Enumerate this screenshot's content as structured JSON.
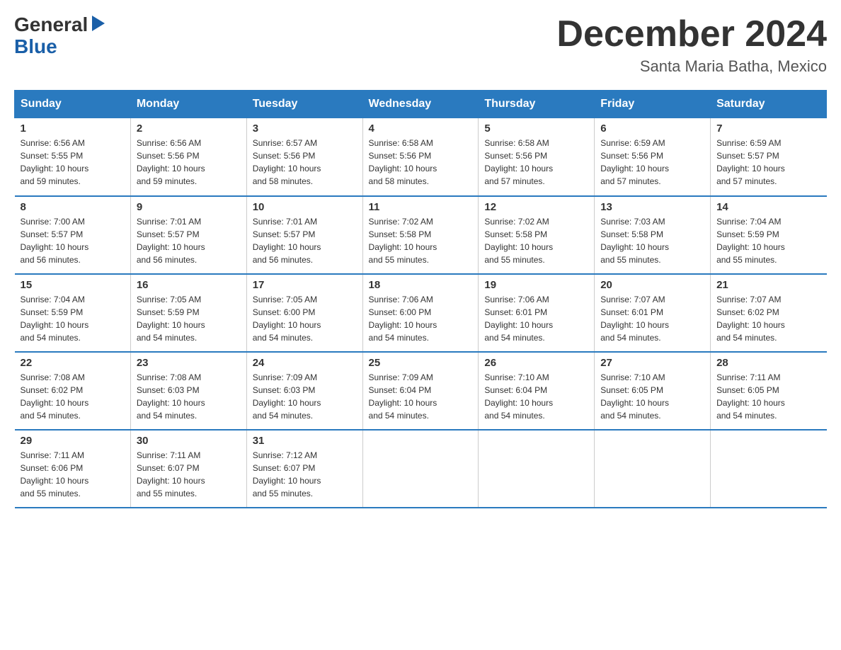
{
  "logo": {
    "text_general": "General",
    "text_blue": "Blue"
  },
  "title": "December 2024",
  "location": "Santa Maria Batha, Mexico",
  "days_of_week": [
    "Sunday",
    "Monday",
    "Tuesday",
    "Wednesday",
    "Thursday",
    "Friday",
    "Saturday"
  ],
  "weeks": [
    [
      {
        "day": "1",
        "sunrise": "6:56 AM",
        "sunset": "5:55 PM",
        "daylight": "10 hours and 59 minutes."
      },
      {
        "day": "2",
        "sunrise": "6:56 AM",
        "sunset": "5:56 PM",
        "daylight": "10 hours and 59 minutes."
      },
      {
        "day": "3",
        "sunrise": "6:57 AM",
        "sunset": "5:56 PM",
        "daylight": "10 hours and 58 minutes."
      },
      {
        "day": "4",
        "sunrise": "6:58 AM",
        "sunset": "5:56 PM",
        "daylight": "10 hours and 58 minutes."
      },
      {
        "day": "5",
        "sunrise": "6:58 AM",
        "sunset": "5:56 PM",
        "daylight": "10 hours and 57 minutes."
      },
      {
        "day": "6",
        "sunrise": "6:59 AM",
        "sunset": "5:56 PM",
        "daylight": "10 hours and 57 minutes."
      },
      {
        "day": "7",
        "sunrise": "6:59 AM",
        "sunset": "5:57 PM",
        "daylight": "10 hours and 57 minutes."
      }
    ],
    [
      {
        "day": "8",
        "sunrise": "7:00 AM",
        "sunset": "5:57 PM",
        "daylight": "10 hours and 56 minutes."
      },
      {
        "day": "9",
        "sunrise": "7:01 AM",
        "sunset": "5:57 PM",
        "daylight": "10 hours and 56 minutes."
      },
      {
        "day": "10",
        "sunrise": "7:01 AM",
        "sunset": "5:57 PM",
        "daylight": "10 hours and 56 minutes."
      },
      {
        "day": "11",
        "sunrise": "7:02 AM",
        "sunset": "5:58 PM",
        "daylight": "10 hours and 55 minutes."
      },
      {
        "day": "12",
        "sunrise": "7:02 AM",
        "sunset": "5:58 PM",
        "daylight": "10 hours and 55 minutes."
      },
      {
        "day": "13",
        "sunrise": "7:03 AM",
        "sunset": "5:58 PM",
        "daylight": "10 hours and 55 minutes."
      },
      {
        "day": "14",
        "sunrise": "7:04 AM",
        "sunset": "5:59 PM",
        "daylight": "10 hours and 55 minutes."
      }
    ],
    [
      {
        "day": "15",
        "sunrise": "7:04 AM",
        "sunset": "5:59 PM",
        "daylight": "10 hours and 54 minutes."
      },
      {
        "day": "16",
        "sunrise": "7:05 AM",
        "sunset": "5:59 PM",
        "daylight": "10 hours and 54 minutes."
      },
      {
        "day": "17",
        "sunrise": "7:05 AM",
        "sunset": "6:00 PM",
        "daylight": "10 hours and 54 minutes."
      },
      {
        "day": "18",
        "sunrise": "7:06 AM",
        "sunset": "6:00 PM",
        "daylight": "10 hours and 54 minutes."
      },
      {
        "day": "19",
        "sunrise": "7:06 AM",
        "sunset": "6:01 PM",
        "daylight": "10 hours and 54 minutes."
      },
      {
        "day": "20",
        "sunrise": "7:07 AM",
        "sunset": "6:01 PM",
        "daylight": "10 hours and 54 minutes."
      },
      {
        "day": "21",
        "sunrise": "7:07 AM",
        "sunset": "6:02 PM",
        "daylight": "10 hours and 54 minutes."
      }
    ],
    [
      {
        "day": "22",
        "sunrise": "7:08 AM",
        "sunset": "6:02 PM",
        "daylight": "10 hours and 54 minutes."
      },
      {
        "day": "23",
        "sunrise": "7:08 AM",
        "sunset": "6:03 PM",
        "daylight": "10 hours and 54 minutes."
      },
      {
        "day": "24",
        "sunrise": "7:09 AM",
        "sunset": "6:03 PM",
        "daylight": "10 hours and 54 minutes."
      },
      {
        "day": "25",
        "sunrise": "7:09 AM",
        "sunset": "6:04 PM",
        "daylight": "10 hours and 54 minutes."
      },
      {
        "day": "26",
        "sunrise": "7:10 AM",
        "sunset": "6:04 PM",
        "daylight": "10 hours and 54 minutes."
      },
      {
        "day": "27",
        "sunrise": "7:10 AM",
        "sunset": "6:05 PM",
        "daylight": "10 hours and 54 minutes."
      },
      {
        "day": "28",
        "sunrise": "7:11 AM",
        "sunset": "6:05 PM",
        "daylight": "10 hours and 54 minutes."
      }
    ],
    [
      {
        "day": "29",
        "sunrise": "7:11 AM",
        "sunset": "6:06 PM",
        "daylight": "10 hours and 55 minutes."
      },
      {
        "day": "30",
        "sunrise": "7:11 AM",
        "sunset": "6:07 PM",
        "daylight": "10 hours and 55 minutes."
      },
      {
        "day": "31",
        "sunrise": "7:12 AM",
        "sunset": "6:07 PM",
        "daylight": "10 hours and 55 minutes."
      },
      null,
      null,
      null,
      null
    ]
  ],
  "labels": {
    "sunrise": "Sunrise:",
    "sunset": "Sunset:",
    "daylight": "Daylight:"
  }
}
